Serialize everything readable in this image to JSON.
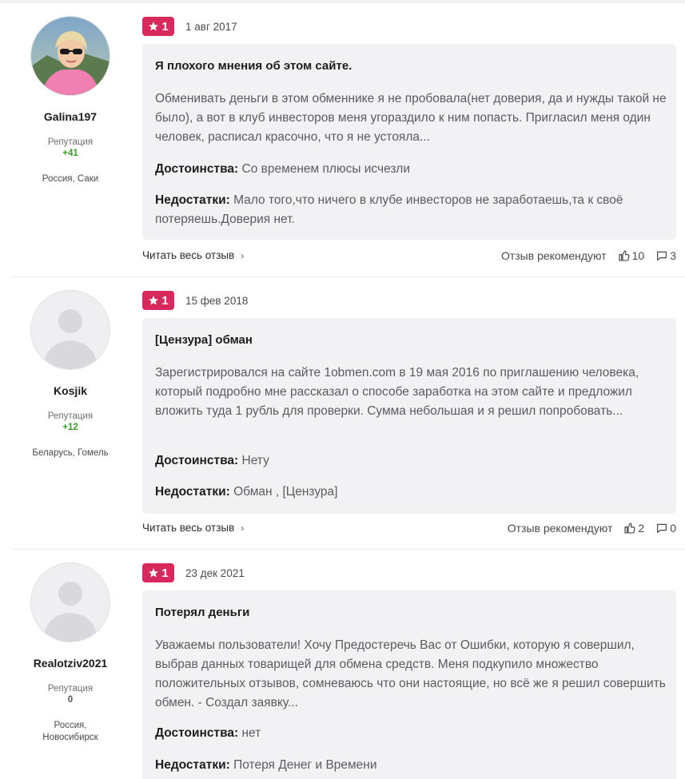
{
  "reviews": [
    {
      "author": "Galina197",
      "avatar": "photo-avatar",
      "reputation_label": "Репутация",
      "reputation_value": "+41",
      "location": "Россия, Саки",
      "rating": "1",
      "date": "1 авг 2017",
      "title": "Я плохого мнения об этом сайте.",
      "text": "Обменивать деньги в этом обменнике я не пробовала(нет доверия, да и нужды такой не было), а вот в клуб инвесторов меня угораздило к ним попасть. Пригласил меня один человек, расписал красочно, что я не устояла...",
      "pros_label": "Достоинства:",
      "pros": "Со временем плюсы исчезли",
      "cons_label": "Недостатки:",
      "cons": "Мало того,что ничего в клубе инвесторов не заработаешь,та к своё потеряешь.Доверия нет.",
      "read_more": "Читать весь отзыв",
      "recommend": "Отзыв рекомендуют",
      "likes": "10",
      "comments": "3"
    },
    {
      "author": "Kosjik",
      "avatar": "default-avatar",
      "reputation_label": "Репутация",
      "reputation_value": "+12",
      "location": "Беларусь, Гомель",
      "rating": "1",
      "date": "15 фев 2018",
      "title": "[Цензура] обман",
      "text": "Зарегистрировался на сайте 1obmen.com в 19 мая 2016 по приглашению человека, который подробно мне рассказал о способе заработка на этом сайте и предложил вложить туда 1 рубль для проверки. Сумма небольшая и я решил попробовать...",
      "pros_label": "Достоинства:",
      "pros": "Нету",
      "cons_label": "Недостатки:",
      "cons": "Обман , [Цензура]",
      "read_more": "Читать весь отзыв",
      "recommend": "Отзыв рекомендуют",
      "likes": "2",
      "comments": "0"
    },
    {
      "author": "Realotziv2021",
      "avatar": "default-avatar",
      "reputation_label": "Репутация",
      "reputation_value": "0",
      "location": "Россия, Новосибирск",
      "rating": "1",
      "date": "23 дек 2021",
      "title": "Потерял деньги",
      "text": "Уважаемы пользователи! Хочу Предостеречь Вас от Ошибки, которую я совершил, выбрав данных товарищей для обмена средств. Меня подкупило множество положительных отзывов, сомневаюсь что они настоящие, но всё же я решил совершить обмен. - Создал заявку...",
      "pros_label": "Достоинства:",
      "pros": "нет",
      "cons_label": "Недостатки:",
      "cons": "Потеря Денег и Времени"
    }
  ],
  "colors": {
    "rating_badge": "#d8295c",
    "reputation_positive": "#3a9a2a",
    "card_background": "#f2f2f4"
  },
  "icons": [
    "star-icon",
    "thumbs-up-icon",
    "comment-icon",
    "chevron-right-icon",
    "user-placeholder-icon"
  ]
}
